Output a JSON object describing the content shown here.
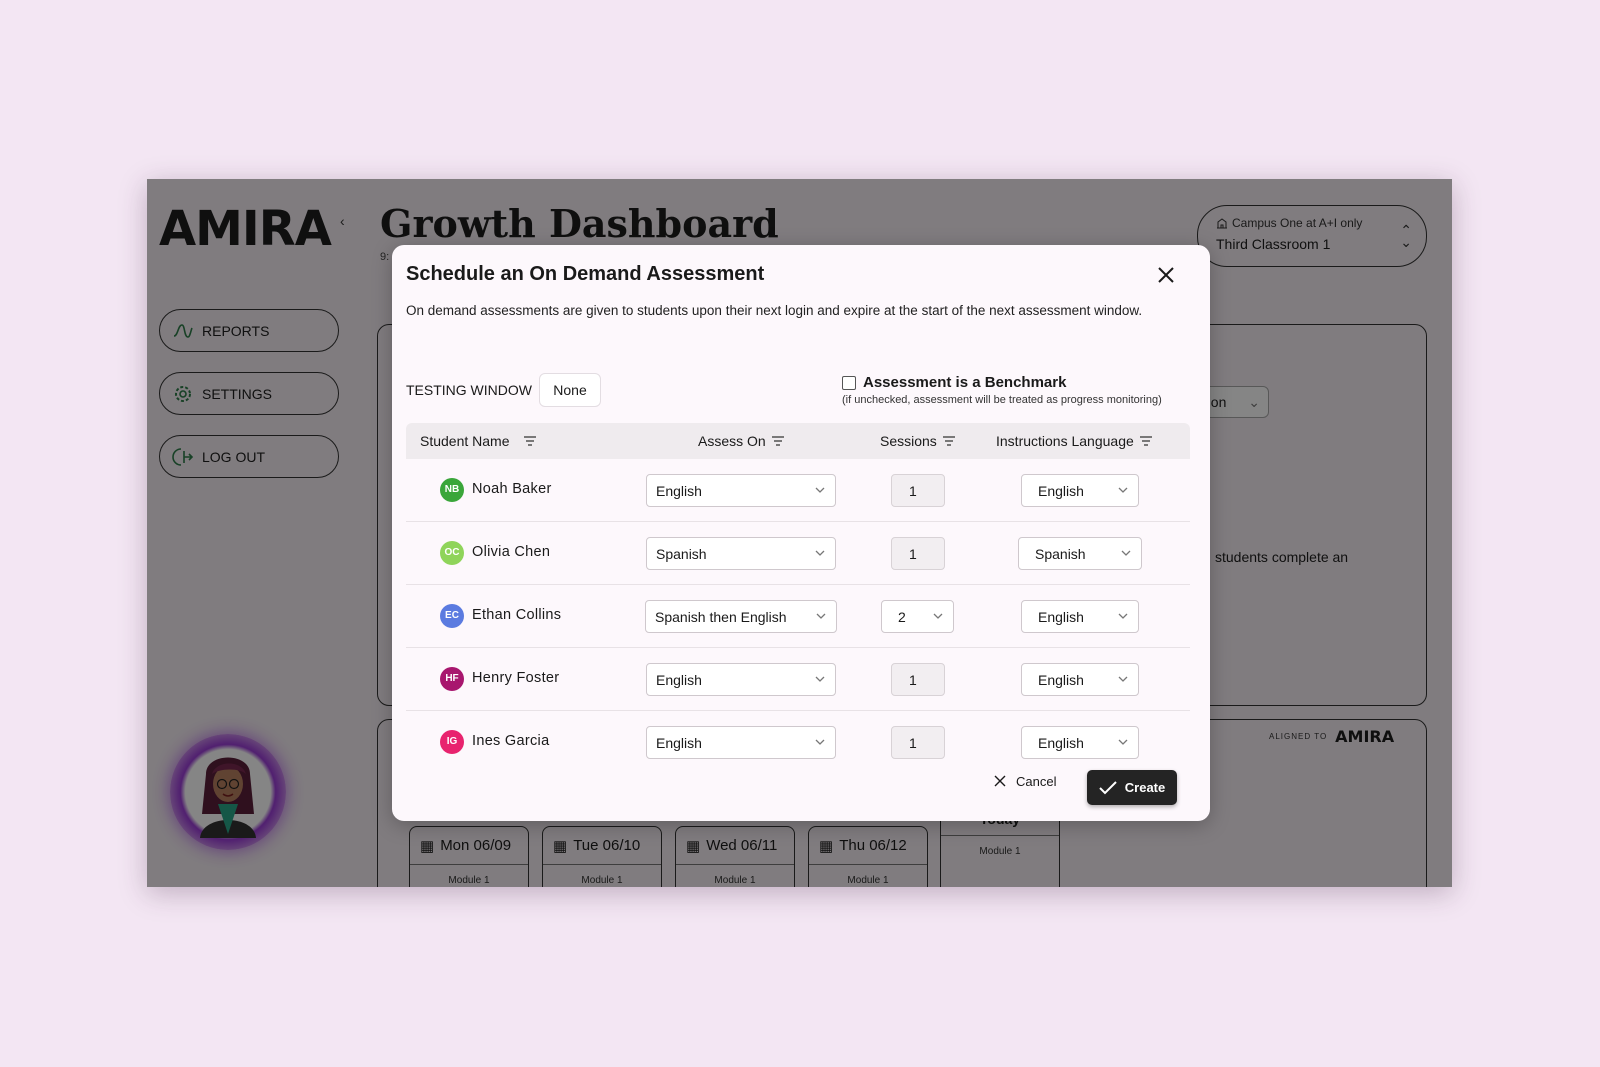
{
  "app": {
    "logo": "AMIRA",
    "collapse_chevron": "‹",
    "title": "Growth Dashboard",
    "subtitle_trunc": "9:",
    "nav": [
      {
        "label": "REPORTS",
        "icon": "reports-icon"
      },
      {
        "label": "SETTINGS",
        "icon": "gear-icon"
      },
      {
        "label": "LOG OUT",
        "icon": "logout-icon"
      }
    ],
    "campus": {
      "top": "Campus One at A+I only",
      "main": "Third Classroom 1"
    },
    "bg_select": "ation",
    "bg_text": "students complete an",
    "aligned": {
      "small": "ALIGNED TO",
      "logo": "AMIRA"
    },
    "days": [
      {
        "label": "Mon 06/09",
        "module": "Module 1"
      },
      {
        "label": "Tue 06/10",
        "module": "Module 1"
      },
      {
        "label": "Wed 06/11",
        "module": "Module 1"
      },
      {
        "label": "Thu 06/12",
        "module": "Module 1"
      }
    ],
    "today": {
      "label": "Today",
      "module": "Module 1"
    }
  },
  "modal": {
    "title": "Schedule an On Demand Assessment",
    "description": "On demand assessments are given to students upon their next login and expire at the start of the next assessment window.",
    "testing_window_label": "TESTING WINDOW",
    "testing_window_value": "None",
    "benchmark_label": "Assessment is a Benchmark",
    "benchmark_checked": false,
    "benchmark_note": "(if unchecked, assessment will be treated as progress monitoring)",
    "columns": [
      "Student Name",
      "Assess On",
      "Sessions",
      "Instructions Language"
    ],
    "students": [
      {
        "initials": "NB",
        "color": "#3aa63a",
        "name": "Noah Baker",
        "assess_on": "English",
        "sessions": "1",
        "sessions_dropdown": false,
        "language": "English"
      },
      {
        "initials": "OC",
        "color": "#8fd45a",
        "name": "Olivia Chen",
        "assess_on": "Spanish",
        "sessions": "1",
        "sessions_dropdown": false,
        "language": "Spanish"
      },
      {
        "initials": "EC",
        "color": "#5b7be0",
        "name": "Ethan Collins",
        "assess_on": "Spanish then English",
        "sessions": "2",
        "sessions_dropdown": true,
        "language": "English"
      },
      {
        "initials": "HF",
        "color": "#a8166e",
        "name": "Henry Foster",
        "assess_on": "English",
        "sessions": "1",
        "sessions_dropdown": false,
        "language": "English"
      },
      {
        "initials": "IG",
        "color": "#e8236e",
        "name": "Ines Garcia",
        "assess_on": "English",
        "sessions": "1",
        "sessions_dropdown": false,
        "language": "English"
      }
    ],
    "cancel_label": "Cancel",
    "create_label": "Create"
  }
}
